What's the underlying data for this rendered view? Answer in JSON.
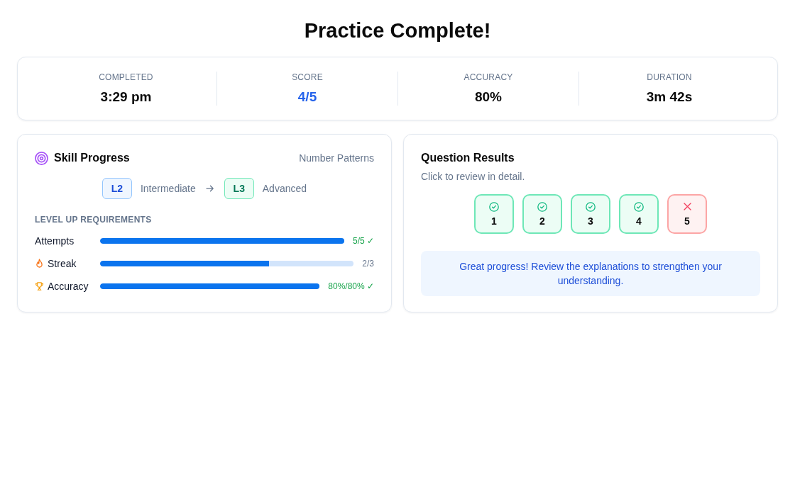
{
  "title": "Practice Complete!",
  "stats": [
    {
      "label": "COMPLETED",
      "value": "3:29 pm",
      "highlighted": false
    },
    {
      "label": "SCORE",
      "value": "4/5",
      "highlighted": true
    },
    {
      "label": "ACCURACY",
      "value": "80%",
      "highlighted": false
    },
    {
      "label": "DURATION",
      "value": "3m 42s",
      "highlighted": false
    }
  ],
  "skill_progress": {
    "title": "Skill Progress",
    "topic": "Number Patterns",
    "levels": [
      {
        "kind": "current",
        "code": "L2",
        "name": "Intermediate"
      },
      {
        "kind": "target",
        "code": "L3",
        "name": "Advanced"
      }
    ],
    "requirements_heading": "LEVEL UP REQUIREMENTS",
    "requirements": [
      {
        "kind": "attempts",
        "label": "Attempts",
        "level": 1,
        "reading": "5/5 ✓",
        "met": true
      },
      {
        "kind": "streak",
        "label": "Streak",
        "level": 0.667,
        "reading": "2/3",
        "met": false
      },
      {
        "kind": "accuracy",
        "label": "Accuracy",
        "level": 1,
        "reading": "80%/80% ✓",
        "met": true
      }
    ]
  },
  "question_results": {
    "title": "Question Results",
    "subtitle": "Click to review in detail.",
    "questions": [
      {
        "number": "1",
        "correct": true
      },
      {
        "number": "2",
        "correct": true
      },
      {
        "number": "3",
        "correct": true
      },
      {
        "number": "4",
        "correct": true
      },
      {
        "number": "5",
        "correct": false
      }
    ],
    "message": "Great progress! Review the explanations to strengthen your understanding."
  }
}
